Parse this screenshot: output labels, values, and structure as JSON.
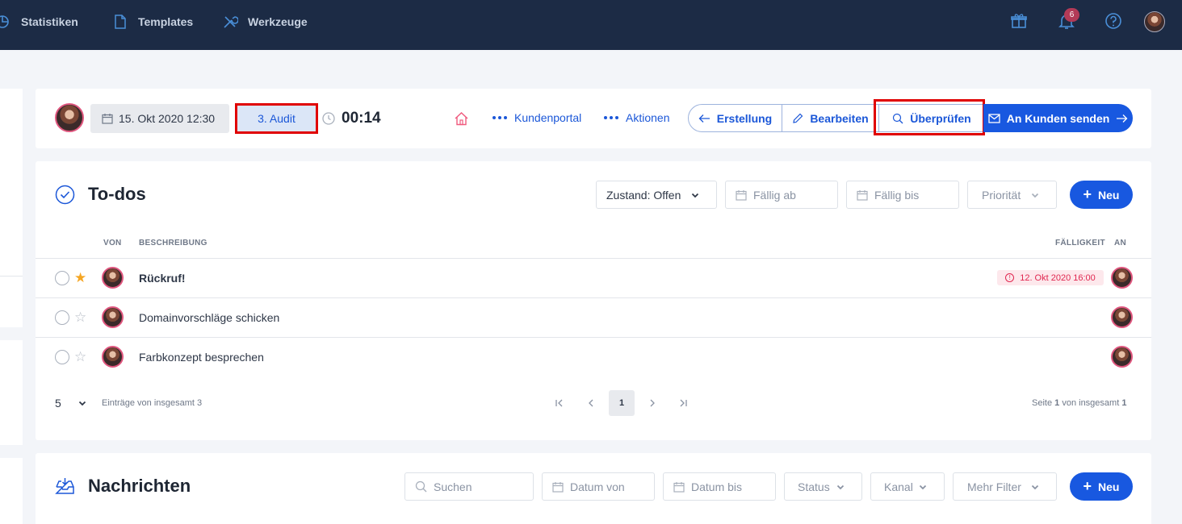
{
  "topnav": {
    "items": [
      {
        "label": "Statistiken",
        "icon": "pie-chart-icon"
      },
      {
        "label": "Templates",
        "icon": "document-icon"
      },
      {
        "label": "Werkzeuge",
        "icon": "tools-icon"
      }
    ],
    "notification_count": "6"
  },
  "header": {
    "date": "15. Okt 2020 12:30",
    "stage": "3. Audit",
    "timer": "00:14",
    "kundenportal": "Kundenportal",
    "aktionen": "Aktionen",
    "erstellung": "Erstellung",
    "bearbeiten": "Bearbeiten",
    "ueberpruefen": "Überprüfen",
    "send": "An Kunden senden"
  },
  "todos": {
    "title": "To-dos",
    "filters": {
      "zustand": "Zustand: Offen",
      "faellig_ab": "Fällig ab",
      "faellig_bis": "Fällig bis",
      "prioritaet": "Priorität"
    },
    "new_label": "Neu",
    "columns": {
      "von": "VON",
      "beschreibung": "BESCHREIBUNG",
      "faelligkeit": "FÄLLIGKEIT",
      "an": "AN"
    },
    "rows": [
      {
        "text": "Rückruf!",
        "starred": true,
        "due": "12. Okt 2020 16:00"
      },
      {
        "text": "Domainvorschläge schicken",
        "starred": false,
        "due": ""
      },
      {
        "text": "Farbkonzept besprechen",
        "starred": false,
        "due": ""
      }
    ],
    "page_size": "5",
    "entries_prefix": "Einträge von insgesamt",
    "entries_total": "3",
    "current_page": "1",
    "page_info_prefix": "Seite",
    "page_info_current": "1",
    "page_info_middle": "von insgesamt",
    "page_info_total": "1"
  },
  "messages": {
    "title": "Nachrichten",
    "search_placeholder": "Suchen",
    "datum_von": "Datum von",
    "datum_bis": "Datum bis",
    "status": "Status",
    "kanal": "Kanal",
    "mehr_filter": "Mehr Filter",
    "new_label": "Neu"
  },
  "colors": {
    "navy": "#1c2b45",
    "primary": "#1858e0",
    "highlight": "#e00000",
    "due_red": "#e0264f"
  }
}
